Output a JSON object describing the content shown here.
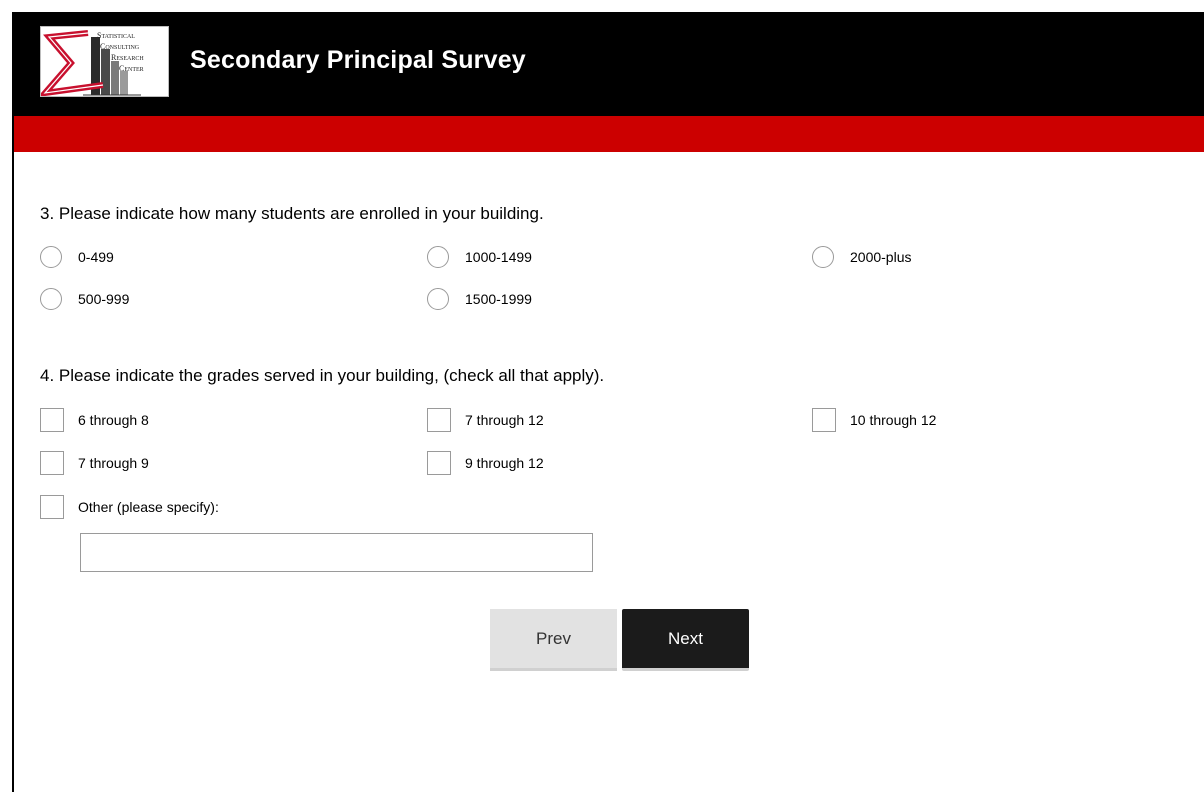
{
  "header": {
    "title": "Secondary Principal Survey",
    "logo_lines": [
      "Statistical",
      "Consulting",
      "Research",
      "Center"
    ]
  },
  "colors": {
    "header_bg": "#000000",
    "accent_bar": "#cc0000",
    "next_button_bg": "#1b1b1b",
    "prev_button_bg": "#e2e2e2"
  },
  "q3": {
    "text": "3. Please indicate how many students are enrolled in your building.",
    "options": [
      "0-499",
      "500-999",
      "1000-1499",
      "1500-1999",
      "2000-plus"
    ]
  },
  "q4": {
    "text": "4. Please indicate the grades served in your building, (check all that apply).",
    "options": [
      "6 through 8",
      "7 through 9",
      "7 through 12",
      "9 through 12",
      "10 through 12"
    ],
    "other_label": "Other (please specify):",
    "other_value": ""
  },
  "nav": {
    "prev_label": "Prev",
    "next_label": "Next"
  }
}
